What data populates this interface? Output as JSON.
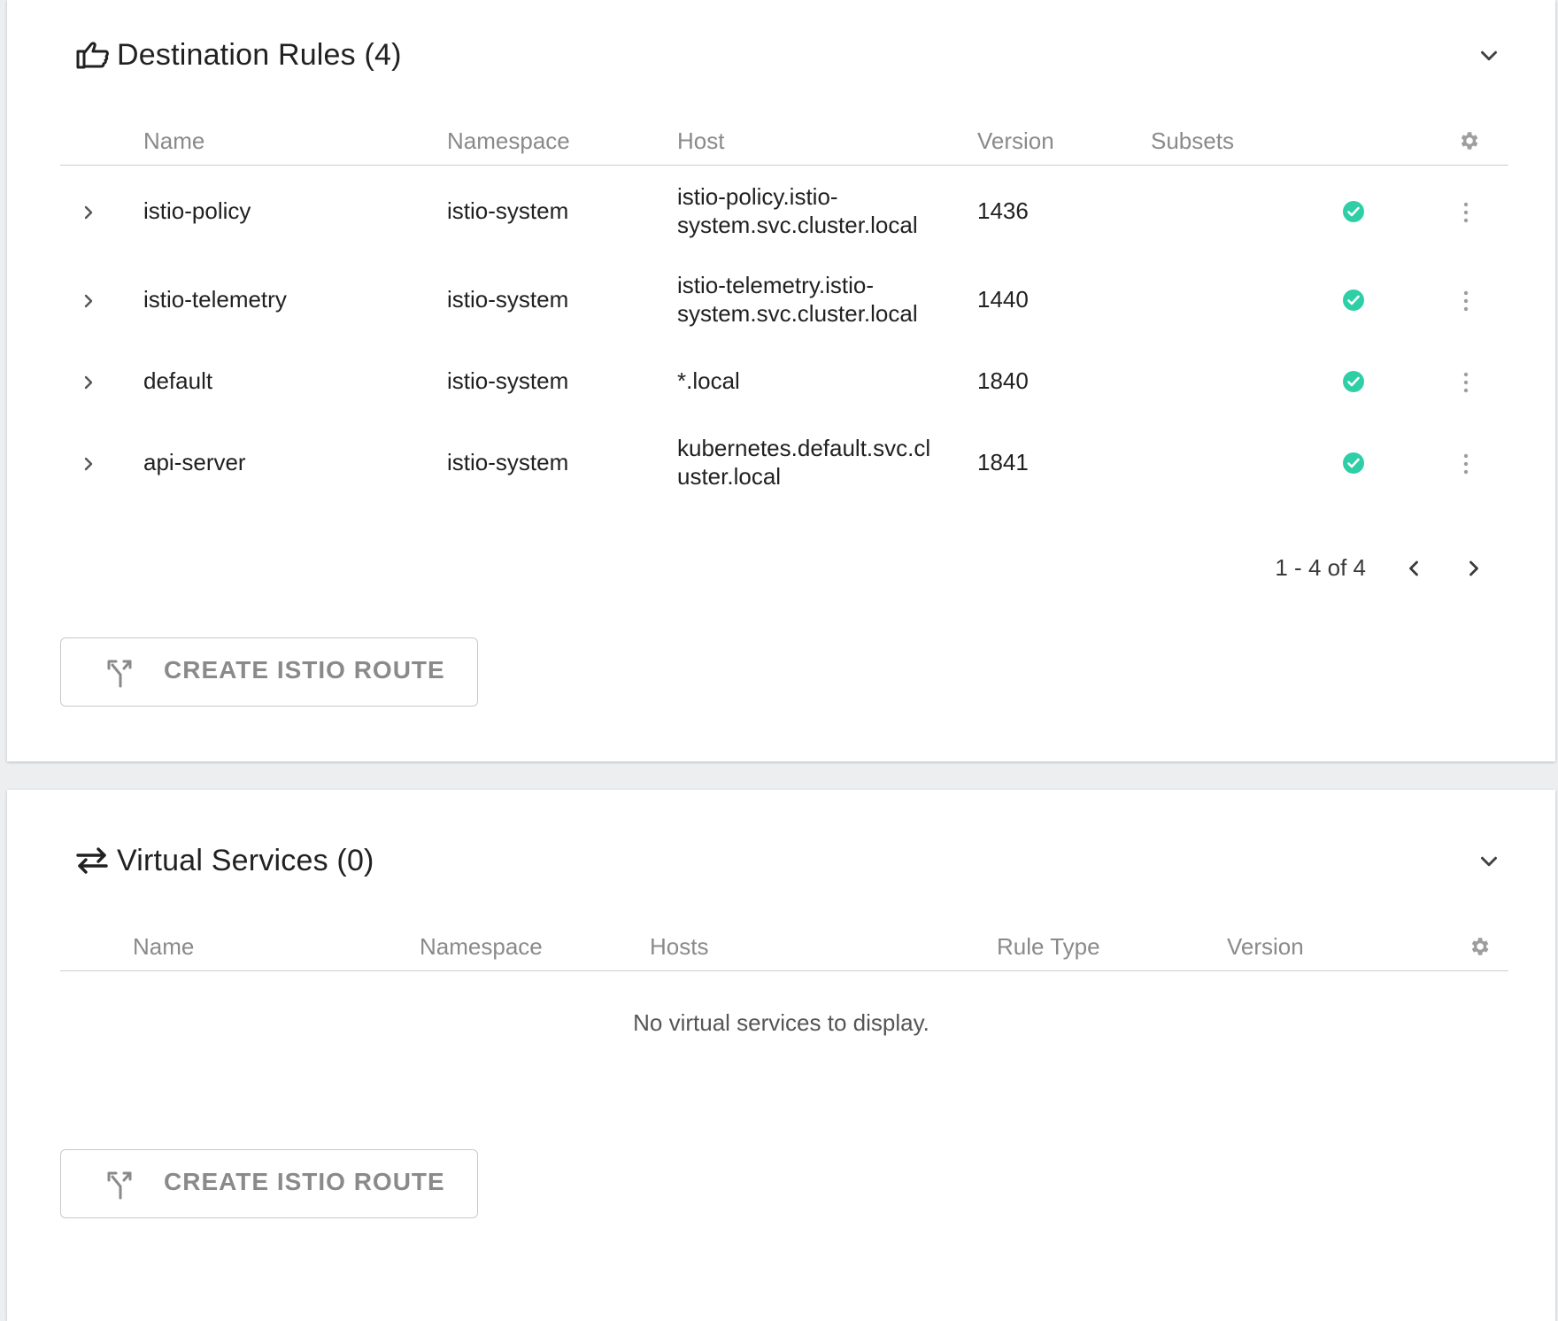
{
  "destination_rules": {
    "title": "Destination Rules (4)",
    "icon": "thumbs-up-pointing-icon",
    "columns": [
      "Name",
      "Namespace",
      "Host",
      "Version",
      "Subsets"
    ],
    "rows": [
      {
        "name": "istio-policy",
        "namespace": "istio-system",
        "host_line1": "istio-policy.istio-",
        "host_line2": "system.svc.cluster.local",
        "version": "1436",
        "status": "ok"
      },
      {
        "name": "istio-telemetry",
        "namespace": "istio-system",
        "host_line1": "istio-telemetry.istio-",
        "host_line2": "system.svc.cluster.local",
        "version": "1440",
        "status": "ok"
      },
      {
        "name": "default",
        "namespace": "istio-system",
        "host_line1": "*.local",
        "host_line2": "",
        "version": "1840",
        "status": "ok"
      },
      {
        "name": "api-server",
        "namespace": "istio-system",
        "host_line1": "kubernetes.default.svc.cl",
        "host_line2": "uster.local",
        "version": "1841",
        "status": "ok"
      }
    ],
    "pagination": "1 - 4 of 4",
    "create_button": "CREATE ISTIO ROUTE"
  },
  "virtual_services": {
    "title": "Virtual Services (0)",
    "icon": "swap-arrows-icon",
    "columns": [
      "Name",
      "Namespace",
      "Hosts",
      "Rule Type",
      "Version"
    ],
    "empty_message": "No virtual services to display.",
    "create_button": "CREATE ISTIO ROUTE"
  },
  "colors": {
    "status_ok": "#2ecfa6",
    "muted_text": "#8a8a8a",
    "background": "#eceef0"
  }
}
